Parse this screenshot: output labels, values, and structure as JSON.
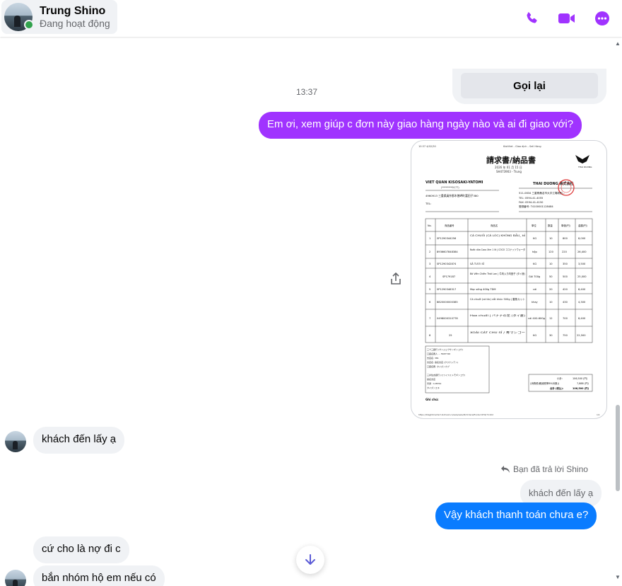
{
  "header": {
    "contact_name": "Trung Shino",
    "contact_status": "Đang hoạt động",
    "actions": [
      "phone-icon",
      "video-icon",
      "more-icon"
    ],
    "accent_color": "#a033ff"
  },
  "call_card": {
    "button_label": "Gọi lại"
  },
  "timestamp": "13:37",
  "messages": {
    "m1": "Em ơi, xem giúp c đơn này giao hàng ngày nào và ai đi giao với?",
    "m2": "khách đến lấy ạ",
    "replied_label": "Bạn đã trả lời Shino",
    "quoted": "khách đến lấy ạ",
    "m3": "Vậy khách thanh toán chưa e?",
    "m4": "cứ cho là nợ đi c",
    "m5": "bắn nhóm hộ em nếu có"
  },
  "document": {
    "page_header_left": "10:37 4/02/30",
    "page_header_center": "KiotViet - Giao dịch - Sell Hàng",
    "title": "請求書/納品書",
    "date_line": "2026 年 01 月 15 日",
    "code_line": "SH473903 - Trung",
    "brand_small": "THAI DUONG",
    "buyer_name": "VIET QUAN KISOSAKI-YATOMI",
    "buyer_sub": "(********9177)",
    "buyer_addr": "4960913 三重県員弁郡木曽岬町富田子380",
    "buyer_tel": "TEL:",
    "seller_name": "THAI DUONG 株式会社",
    "seller_lines": [
      "511-0834 三重県桑名市大字江場新田...",
      "TEL: 0594-41-4055",
      "FAX: 0594-41-4150",
      "登録番号: T4100001128484"
    ],
    "columns": [
      "No.",
      "商品番号",
      "商品名",
      "単位",
      "数量",
      "単価(円)",
      "金額(円)"
    ],
    "rows": [
      [
        "1",
        "SP1290344256",
        "CÁ CHUỐI (CÁ LÓC) KHÔNG ĐẦU_ tổ",
        "KG",
        "10",
        "800",
        "8,000"
      ],
      [
        "2",
        "8936607848384",
        "Nước dừa Coco Xim 1 lít | COCO ココナッツウォータ",
        "hộp",
        "120",
        "220",
        "26,400"
      ],
      [
        "3",
        "SP1290342874",
        "SẢ TƯƠI SỈ",
        "KG",
        "10",
        "350",
        "3,500"
      ],
      [
        "4",
        "SP179187",
        "Bò Viên Chiên Thái Lan | 牛肉入り肉団子 (タイ産)",
        "Gói 700g",
        "50",
        "500",
        "25,000"
      ],
      [
        "5",
        "SP1290346317",
        "Mọc sống 400g TDM",
        "cái",
        "20",
        "420",
        "8,400"
      ],
      [
        "6",
        "8820000000385",
        "Cá chuối (cá lóc) cắt khúc 500g | 雷魚カット",
        "khay",
        "10",
        "430",
        "4,300"
      ],
      [
        "7",
        "0498000310778",
        "Hoa chuối | バナナの花 (タイ産)",
        "cái 400-600g",
        "12",
        "700",
        "8,400"
      ],
      [
        "8",
        "25",
        "XOÀI CÁT CHU SỈ / 青マンゴー",
        "KG",
        "30",
        "750",
        "22,500"
      ]
    ],
    "bank_lines": [
      "三十三銀行 (サンジュウサンギンコウ)",
      "口座名義人 ... 5667746",
      "支店名: 381",
      "支店名: 桑名支店 (クワナシテン)",
      "口座名義: タイズンカブ",
      "",
      "三井住友銀行 (ミツイスミトモギンコウ)",
      "桑名支店",
      "普通 : 128762",
      "タイズンエキ"
    ],
    "totals": [
      [
        "小計:",
        "106,500 (円)"
      ],
      [
        "(消費税(軽減税率8%対象))",
        "7,888 (円)"
      ],
      [
        "合計 (税込):",
        "106,500 (円)"
      ]
    ],
    "note_label": "Ghi chú:",
    "footer_url": "https://tdsghtmartart.kiotviet.vn/sale/sale/#/Orders/Ex/de=0H4/71102",
    "footer_page": "1/1"
  }
}
